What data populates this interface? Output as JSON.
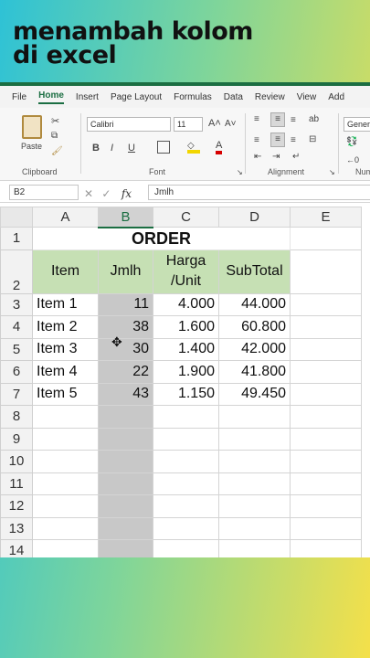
{
  "caption": {
    "line1": "menambah kolom",
    "line2": "di excel"
  },
  "menu": [
    "File",
    "Home",
    "Insert",
    "Page Layout",
    "Formulas",
    "Data",
    "Review",
    "View",
    "Add"
  ],
  "ribbon": {
    "paste_label": "Paste",
    "clipboard_label": "Clipboard",
    "font_name": "Calibri",
    "font_size": "11",
    "font_label": "Font",
    "alignment_label": "Alignment",
    "number_format": "Genera",
    "number_label": "Num",
    "bold": "B",
    "italic": "I",
    "underline": "U"
  },
  "formula_bar": {
    "name_box": "B2",
    "fx": "fx",
    "content": "Jmlh"
  },
  "columns": [
    "A",
    "B",
    "C",
    "D",
    "E"
  ],
  "rows": [
    "1",
    "2",
    "3",
    "4",
    "5",
    "6",
    "7",
    "8",
    "9",
    "10",
    "11",
    "12",
    "13",
    "14"
  ],
  "sheet": {
    "title": "ORDER",
    "headers": {
      "item": "Item",
      "jmlh": "Jmlh",
      "harga_1": "Harga",
      "harga_2": "/Unit",
      "subtotal": "SubTotal"
    },
    "data": [
      {
        "item": "Item 1",
        "jmlh": "11",
        "harga": "4.000",
        "subtotal": "44.000"
      },
      {
        "item": "Item 2",
        "jmlh": "38",
        "harga": "1.600",
        "subtotal": "60.800"
      },
      {
        "item": "Item 3",
        "jmlh": "30",
        "harga": "1.400",
        "subtotal": "42.000"
      },
      {
        "item": "Item 4",
        "jmlh": "22",
        "harga": "1.900",
        "subtotal": "41.800"
      },
      {
        "item": "Item 5",
        "jmlh": "43",
        "harga": "1.150",
        "subtotal": "49.450"
      }
    ]
  },
  "colors": {
    "excel_green": "#1b6e42",
    "header_fill": "#c6e0b4",
    "selected_column": "#c8c8c8"
  }
}
